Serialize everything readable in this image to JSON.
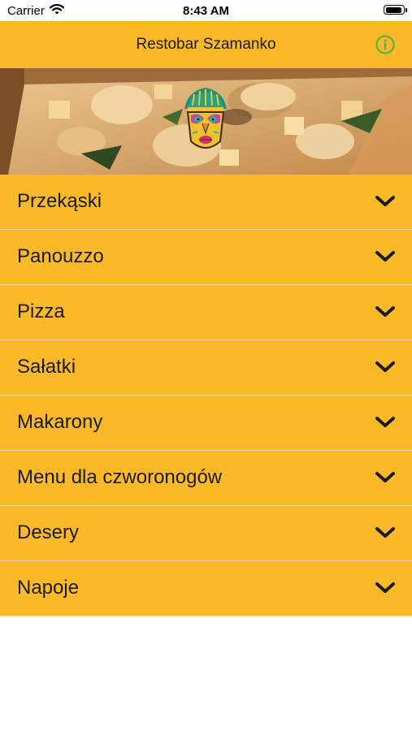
{
  "status_bar": {
    "carrier": "Carrier",
    "time": "8:43 AM",
    "battery_level": 0.95
  },
  "nav": {
    "title": "Restobar Szamanko",
    "info_icon": "info-icon",
    "accent_color": "#4caf50"
  },
  "banner": {
    "image": "pizza-photo",
    "logo": "shaman-mask-logo"
  },
  "colors": {
    "primary": "#fbb927",
    "text": "#1a1a1a",
    "separator": "#fde29a"
  },
  "menu": {
    "items": [
      {
        "label": "Przekąski"
      },
      {
        "label": "Panouzzo"
      },
      {
        "label": "Pizza"
      },
      {
        "label": "Sałatki"
      },
      {
        "label": "Makarony"
      },
      {
        "label": "Menu dla czworonogów"
      },
      {
        "label": "Desery"
      },
      {
        "label": "Napoje"
      }
    ],
    "chevron_icon": "chevron-down-icon"
  }
}
